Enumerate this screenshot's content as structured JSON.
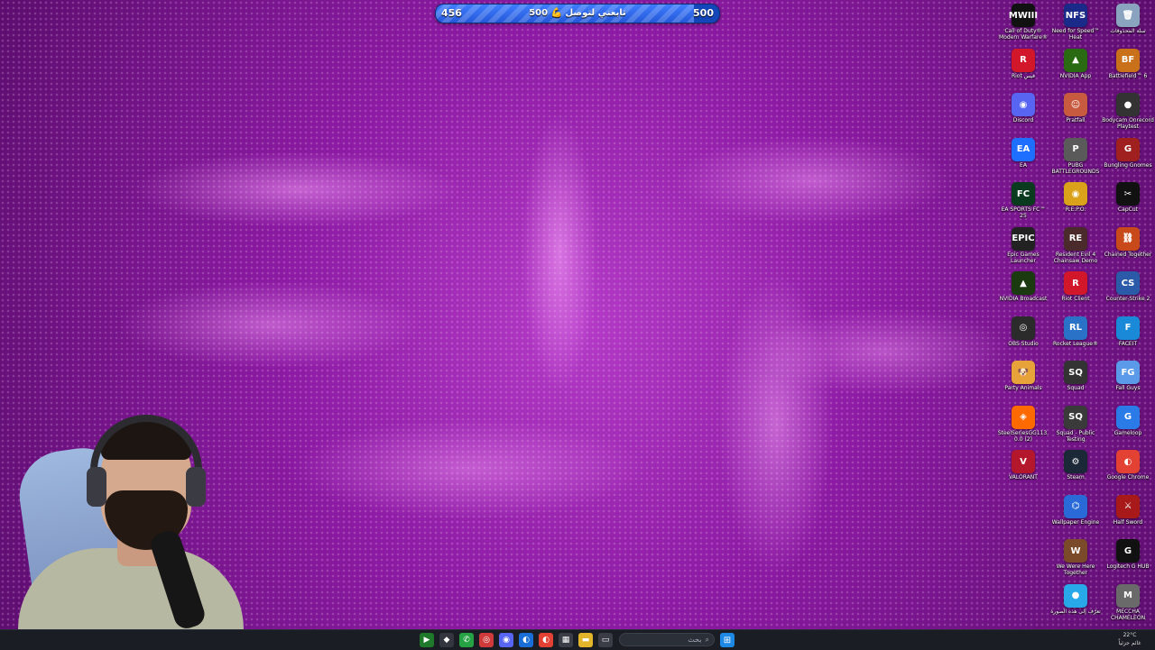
{
  "goal_widget": {
    "current": "456",
    "target": "500",
    "label": "تابعني لتوصل 💪 500",
    "progress_fraction": 0.912
  },
  "desktop_icons": {
    "col1": [
      {
        "label": "Call of Duty® Modern Warfare® III",
        "glyph": "MWIII",
        "color": "#111111",
        "icon": "cod-mw3-icon"
      },
      {
        "label": "Riot فيس",
        "glyph": "R",
        "color": "#d3172b",
        "icon": "riot-icon"
      },
      {
        "label": "Discord",
        "glyph": "◉",
        "color": "#5865f2",
        "icon": "discord-icon"
      },
      {
        "label": "EA",
        "glyph": "EA",
        "color": "#1e6fff",
        "icon": "ea-icon"
      },
      {
        "label": "EA SPORTS FC™ 25",
        "glyph": "FC",
        "color": "#0a3b1f",
        "icon": "ea-fc-icon"
      },
      {
        "label": "Epic Games Launcher",
        "glyph": "EPIC",
        "color": "#222222",
        "icon": "epic-games-icon"
      },
      {
        "label": "NVIDIA Broadcast",
        "glyph": "▲",
        "color": "#1b3a10",
        "icon": "nvidia-broadcast-icon"
      },
      {
        "label": "OBS Studio",
        "glyph": "◎",
        "color": "#2b2b2b",
        "icon": "obs-icon"
      },
      {
        "label": "Party Animals",
        "glyph": "🐶",
        "color": "#e8a23a",
        "icon": "party-animals-icon"
      },
      {
        "label": "SteelSeriesGG113.0.0 (2)",
        "glyph": "◈",
        "color": "#ff6a00",
        "icon": "steelseries-icon"
      },
      {
        "label": "VALORANT",
        "glyph": "V",
        "color": "#b4162c",
        "icon": "valorant-icon"
      }
    ],
    "col2": [
      {
        "label": "Need for Speed™ Heat",
        "glyph": "NFS",
        "color": "#1a2a88",
        "icon": "nfs-heat-icon"
      },
      {
        "label": "NVIDIA App",
        "glyph": "▲",
        "color": "#2a6a12",
        "icon": "nvidia-app-icon"
      },
      {
        "label": "Pratfall",
        "glyph": "☺",
        "color": "#c85a40",
        "icon": "pratfall-icon"
      },
      {
        "label": "PUBG BATTLEGROUNDS",
        "glyph": "P",
        "color": "#5a5a5a",
        "icon": "pubg-icon"
      },
      {
        "label": "R.E.P.O.",
        "glyph": "◉",
        "color": "#d9a21a",
        "icon": "repo-icon"
      },
      {
        "label": "Resident Evil 4 Chainsaw Demo",
        "glyph": "RE",
        "color": "#4a2a2a",
        "icon": "re4-icon"
      },
      {
        "label": "Riot Client",
        "glyph": "R",
        "color": "#d3172b",
        "icon": "riot-client-icon"
      },
      {
        "label": "Rocket League®",
        "glyph": "RL",
        "color": "#2a72c8",
        "icon": "rocket-league-icon"
      },
      {
        "label": "Squad",
        "glyph": "SQ",
        "color": "#333333",
        "icon": "squad-icon"
      },
      {
        "label": "Squad - Public Testing",
        "glyph": "SQ",
        "color": "#3a3a3a",
        "icon": "squad-testing-icon"
      },
      {
        "label": "Steam",
        "glyph": "⚙",
        "color": "#1b2838",
        "icon": "steam-icon"
      },
      {
        "label": "Wallpaper Engine",
        "glyph": "⌬",
        "color": "#2a6ad8",
        "icon": "wallpaper-engine-icon"
      },
      {
        "label": "We Were Here Together",
        "glyph": "W",
        "color": "#7a4a2a",
        "icon": "we-were-here-icon"
      },
      {
        "label": "تعرّف إلى هذه الصورة",
        "glyph": "●",
        "color": "#28a8e8",
        "icon": "spotlight-icon"
      }
    ],
    "col3": [
      {
        "label": "سلة المحذوفات",
        "glyph": "🗑",
        "color": "#8aa4c0",
        "icon": "recycle-bin-icon"
      },
      {
        "label": "Battlefield™ 6",
        "glyph": "BF",
        "color": "#c8701a",
        "icon": "battlefield-icon"
      },
      {
        "label": "Bodycam Onrecord Playtest",
        "glyph": "●",
        "color": "#333333",
        "icon": "bodycam-icon"
      },
      {
        "label": "Bungling Gnomes",
        "glyph": "G",
        "color": "#a02020",
        "icon": "bungling-gnomes-icon"
      },
      {
        "label": "CapCut",
        "glyph": "✂",
        "color": "#111111",
        "icon": "capcut-icon"
      },
      {
        "label": "Chained Together",
        "glyph": "⛓",
        "color": "#c84a1a",
        "icon": "chained-together-icon"
      },
      {
        "label": "Counter-Strike 2",
        "glyph": "CS",
        "color": "#2a5aa8",
        "icon": "cs2-icon"
      },
      {
        "label": "FACEIT",
        "glyph": "F",
        "color": "#1a8ad8",
        "icon": "faceit-icon"
      },
      {
        "label": "Fall Guys",
        "glyph": "FG",
        "color": "#5a9ae8",
        "icon": "fall-guys-icon"
      },
      {
        "label": "Gameloop",
        "glyph": "G",
        "color": "#2a7ae8",
        "icon": "gameloop-icon"
      },
      {
        "label": "Google Chrome",
        "glyph": "◐",
        "color": "#e34133",
        "icon": "chrome-icon"
      },
      {
        "label": "Half Sword",
        "glyph": "⚔",
        "color": "#a81a1a",
        "icon": "half-sword-icon"
      },
      {
        "label": "Logitech G HUB",
        "glyph": "G",
        "color": "#111111",
        "icon": "logitech-ghub-icon"
      },
      {
        "label": "MECCHA CHAMELEON",
        "glyph": "M",
        "color": "#6a6a6a",
        "icon": "meccha-chameleon-icon"
      }
    ]
  },
  "taskbar": {
    "search_placeholder": "بحث",
    "weather": "22°C",
    "weather_desc": "غائم جزئياً",
    "apps": [
      {
        "glyph": "▶",
        "color": "#1e7a2a",
        "name": "taskbar-app-play",
        "icon": "play-icon"
      },
      {
        "glyph": "◆",
        "color": "#33363e",
        "name": "taskbar-app-game",
        "icon": "game-icon"
      },
      {
        "glyph": "✆",
        "color": "#25a244",
        "name": "taskbar-app-whatsapp",
        "icon": "whatsapp-icon"
      },
      {
        "glyph": "◎",
        "color": "#d03a3a",
        "name": "taskbar-app-steelseries",
        "icon": "steelseries-icon"
      },
      {
        "glyph": "◉",
        "color": "#5865f2",
        "name": "taskbar-app-discord",
        "icon": "discord-icon"
      },
      {
        "glyph": "◐",
        "color": "#1a6ed8",
        "name": "taskbar-app-edge",
        "icon": "browser-icon"
      },
      {
        "glyph": "◐",
        "color": "#e34133",
        "name": "taskbar-app-chrome",
        "icon": "chrome-icon"
      },
      {
        "glyph": "▦",
        "color": "#3a3d46",
        "name": "taskbar-app-store",
        "icon": "store-icon"
      },
      {
        "glyph": "▬",
        "color": "#e3b52a",
        "name": "taskbar-app-explorer",
        "icon": "folder-icon"
      },
      {
        "glyph": "▭",
        "color": "#3a3d46",
        "name": "taskbar-app-task-view",
        "icon": "task-view-icon"
      }
    ]
  }
}
